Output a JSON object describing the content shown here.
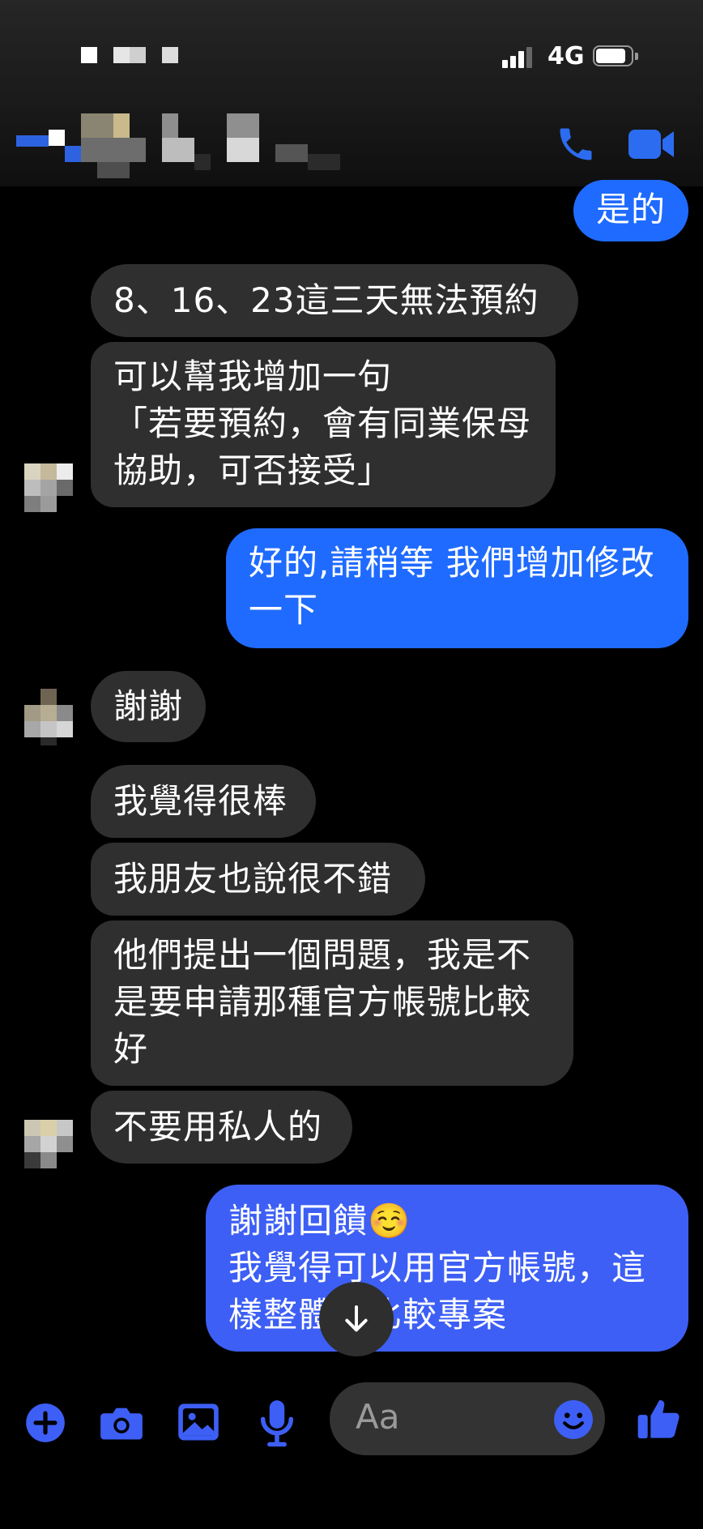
{
  "status_bar": {
    "network": "4G"
  },
  "colors": {
    "accent": "#1f6bff",
    "incoming_bubble": "#2f2f2f",
    "background": "#000000"
  },
  "header": {
    "icons": [
      "back-arrow-icon",
      "phone-icon",
      "video-camera-icon"
    ]
  },
  "messages": [
    {
      "from": "me",
      "text": "是的"
    },
    {
      "from": "them",
      "text": "8、16、23這三天無法預約"
    },
    {
      "from": "them",
      "text": "可以幫我增加一句\n「若要預約，會有同業保母\n協助，可否接受」"
    },
    {
      "from": "me",
      "text": "好的,請稍等 我們增加修改\n一下"
    },
    {
      "from": "them",
      "text": "謝謝"
    },
    {
      "from": "them",
      "text": "我覺得很棒"
    },
    {
      "from": "them",
      "text": "我朋友也說很不錯"
    },
    {
      "from": "them",
      "text": "他們提出一個問題，我是不\n是要申請那種官方帳號比較\n好"
    },
    {
      "from": "them",
      "text": "不要用私人的"
    },
    {
      "from": "me",
      "text": "謝謝回饋☺️\n我覺得可以用官方帳號，這\n樣整體會比較專案"
    }
  ],
  "composer": {
    "placeholder": "Aa",
    "icons": [
      "plus-icon",
      "camera-icon",
      "image-icon",
      "microphone-icon",
      "emoji-icon",
      "thumbs-up-icon"
    ]
  }
}
